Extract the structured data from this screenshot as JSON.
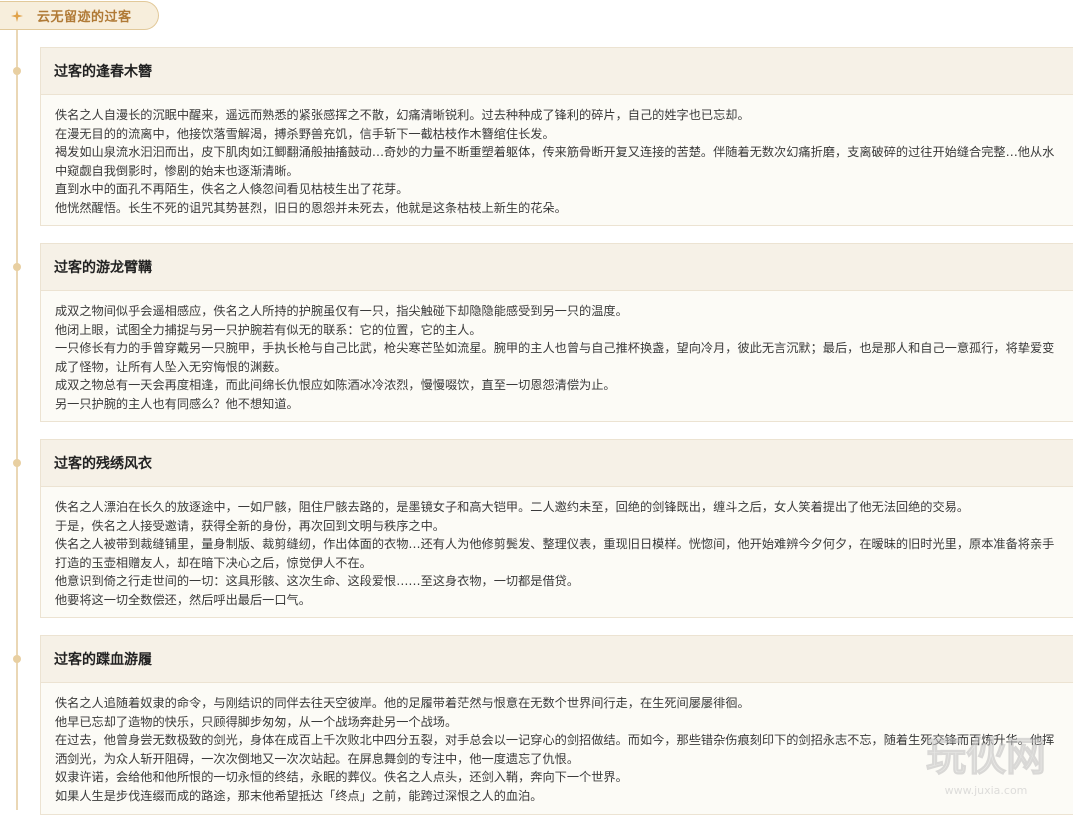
{
  "set": {
    "title": "云无留迹的过客"
  },
  "cards": [
    {
      "title": "过客的逢春木簪",
      "lines": [
        "佚名之人自漫长的沉眠中醒来，遥远而熟悉的紧张感挥之不散，幻痛清晰锐利。过去种种成了锋利的碎片，自己的姓字也已忘却。",
        "在漫无目的的流离中，他接饮落雪解渴，搏杀野兽充饥，信手斩下一截枯枝作木簪绾住长发。",
        "褐发如山泉流水汩汩而出，皮下肌肉如江鲫翻涌般抽搐鼓动…奇妙的力量不断重塑着躯体，传来筋骨断开复又连接的苦楚。伴随着无数次幻痛折磨，支离破碎的过往开始缝合完整…他从水中窥觑自我倒影时，惨剧的始末也逐渐清晰。",
        "直到水中的面孔不再陌生，佚名之人倏忽间看见枯枝生出了花芽。",
        "他恍然醒悟。长生不死的诅咒其势甚烈，旧日的恩怨并未死去，他就是这条枯枝上新生的花朵。"
      ]
    },
    {
      "title": "过客的游龙臂鞲",
      "lines": [
        "成双之物间似乎会遥相感应，佚名之人所持的护腕虽仅有一只，指尖触碰下却隐隐能感受到另一只的温度。",
        "他闭上眼，试图全力捕捉与另一只护腕若有似无的联系：它的位置，它的主人。",
        "一只修长有力的手曾穿戴另一只腕甲，手执长枪与自己比武，枪尖寒芒坠如流星。腕甲的主人也曾与自己推杯换盏，望向冷月，彼此无言沉默；最后，也是那人和自己一意孤行，将挚爱变成了怪物，让所有人坠入无穷悔恨的渊薮。",
        "成双之物总有一天会再度相逢，而此间绵长仇恨应如陈酒冰冷浓烈，慢慢啜饮，直至一切恩怨清偿为止。",
        "另一只护腕的主人也有同感么？他不想知道。"
      ]
    },
    {
      "title": "过客的残绣风衣",
      "lines": [
        "佚名之人漂泊在长久的放逐途中，一如尸骸，阻住尸骸去路的，是墨镜女子和高大铠甲。二人邀约未至，回绝的剑锋既出，缠斗之后，女人笑着提出了他无法回绝的交易。",
        "于是，佚名之人接受邀请，获得全新的身份，再次回到文明与秩序之中。",
        "佚名之人被带到裁缝铺里，量身制版、裁剪缝纫，作出体面的衣物…还有人为他修剪鬓发、整理仪表，重现旧日模样。恍惚间，他开始难辨今夕何夕，在暧昧的旧时光里，原本准备将亲手打造的玉壶相赠友人，却在暗下决心之后，惊觉伊人不在。",
        "他意识到倚之行走世间的一切：这具形骸、这次生命、这段爱恨……至这身衣物，一切都是借贷。",
        "他要将这一切全数偿还，然后呼出最后一口气。"
      ]
    },
    {
      "title": "过客的蹀血游履",
      "lines": [
        "佚名之人追随着奴隶的命令，与刚结识的同伴去往天空彼岸。他的足履带着茫然与恨意在无数个世界间行走，在生死间屡屡徘徊。",
        "他早已忘却了造物的快乐，只顾得脚步匆匆，从一个战场奔赴另一个战场。",
        "在过去，他曾身尝无数极致的剑光，身体在成百上千次败北中四分五裂，对手总会以一记穿心的剑招做结。而如今，那些错杂伤痕刻印下的剑招永志不忘，随着生死交锋而百炼升华。他挥洒剑光，为众人斩开阻碍，一次次倒地又一次次站起。在屏息舞剑的专注中，他一度遗忘了仇恨。",
        "奴隶许诺，会给他和他所恨的一切永恒的终结，永眠的葬仪。佚名之人点头，还剑入鞘，奔向下一个世界。",
        "如果人生是步伐连缀而成的路途，那末他希望抵达「终点」之前，能跨过深恨之人的血泊。"
      ]
    }
  ],
  "watermark": {
    "text": "玩伙网",
    "url": "www.juxia.com"
  },
  "colors": {
    "accent": "#b07a36",
    "timeline": "#ead7b5",
    "card_head_bg": "#f6f1e7"
  },
  "icons": {
    "set_star": "four-point-star-icon"
  }
}
